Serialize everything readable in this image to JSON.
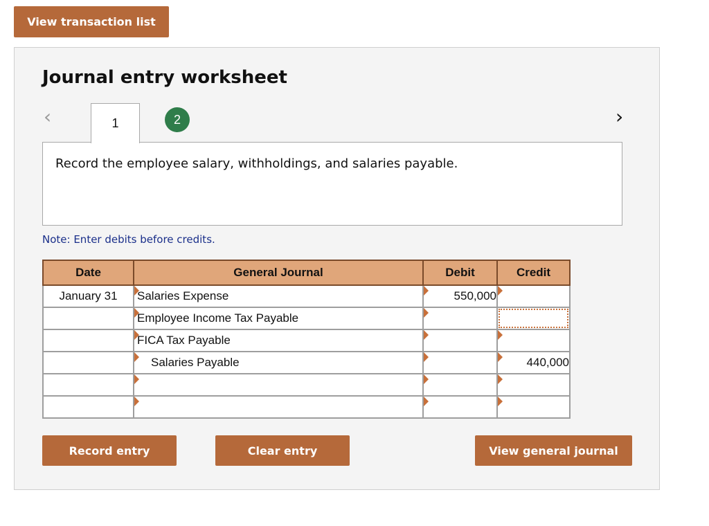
{
  "header": {
    "view_transactions_label": "View transaction list"
  },
  "worksheet": {
    "title": "Journal entry worksheet",
    "tabs": [
      {
        "label": "1"
      },
      {
        "label": "2"
      }
    ],
    "instruction": "Record the employee salary, withholdings, and salaries payable.",
    "note": "Note: Enter debits before credits."
  },
  "journal": {
    "headers": {
      "date": "Date",
      "general_journal": "General Journal",
      "debit": "Debit",
      "credit": "Credit"
    },
    "rows": [
      {
        "date": "January 31",
        "account": "Salaries Expense",
        "debit": "550,000",
        "credit": ""
      },
      {
        "date": "",
        "account": "Employee Income Tax Payable",
        "debit": "",
        "credit": ""
      },
      {
        "date": "",
        "account": "FICA Tax Payable",
        "debit": "",
        "credit": ""
      },
      {
        "date": "",
        "account": "Salaries Payable",
        "debit": "",
        "credit": "440,000"
      },
      {
        "date": "",
        "account": "",
        "debit": "",
        "credit": ""
      },
      {
        "date": "",
        "account": "",
        "debit": "",
        "credit": ""
      }
    ]
  },
  "actions": {
    "record_label": "Record entry",
    "clear_label": "Clear entry",
    "view_journal_label": "View general journal"
  },
  "colors": {
    "button_brown": "#b5693a",
    "header_peach": "#e0a67a",
    "active_tab_green": "#2f7d4a",
    "note_blue": "#1a2f8a"
  },
  "icons": {
    "prev": "chevron-left-icon",
    "next": "chevron-right-icon",
    "cell_marker": "triangle-right-icon"
  }
}
